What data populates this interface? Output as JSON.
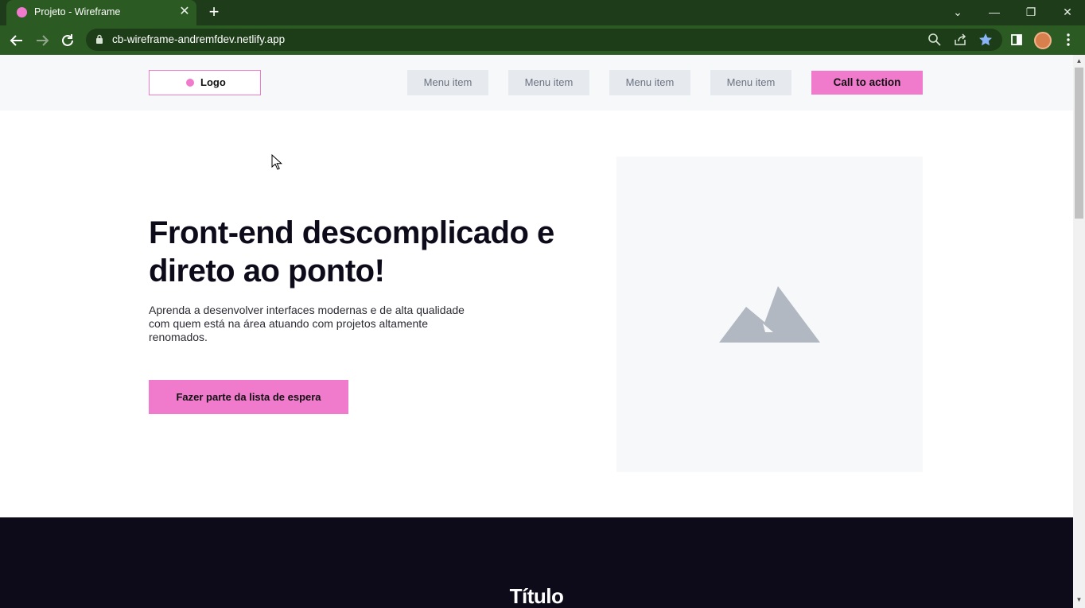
{
  "browser": {
    "tab_title": "Projeto - Wireframe",
    "tab_close": "✕",
    "new_tab": "+",
    "url": "cb-wireframe-andremfdev.netlify.app",
    "window_controls": {
      "tab_search": "⌄",
      "minimize": "—",
      "restore": "❐",
      "close": "✕"
    },
    "icons": [
      "back-arrow-icon",
      "forward-arrow-icon",
      "reload-icon",
      "lock-icon",
      "zoom-icon",
      "share-icon",
      "bookmark-star-icon",
      "side-panel-icon",
      "profile-avatar",
      "more-menu-icon"
    ]
  },
  "site": {
    "logo": "Logo",
    "menu": [
      "Menu item",
      "Menu item",
      "Menu item",
      "Menu item"
    ],
    "cta": "Call to action",
    "hero": {
      "title": "Front-end descomplicado e direto ao ponto!",
      "description": "Aprenda a desenvolver interfaces modernas e de alta qualidade com quem está na área atuando com projetos altamente renomados.",
      "button": "Fazer parte da lista de espera",
      "image_icon": "mountain-image-icon"
    },
    "section": {
      "title": "Título"
    }
  },
  "colors": {
    "accent": "#f07acb",
    "dark": "#0d0b1a",
    "chrome": "#2b5a23",
    "placeholder": "#f7f8fa",
    "menu_bg": "#e6e9ee"
  }
}
